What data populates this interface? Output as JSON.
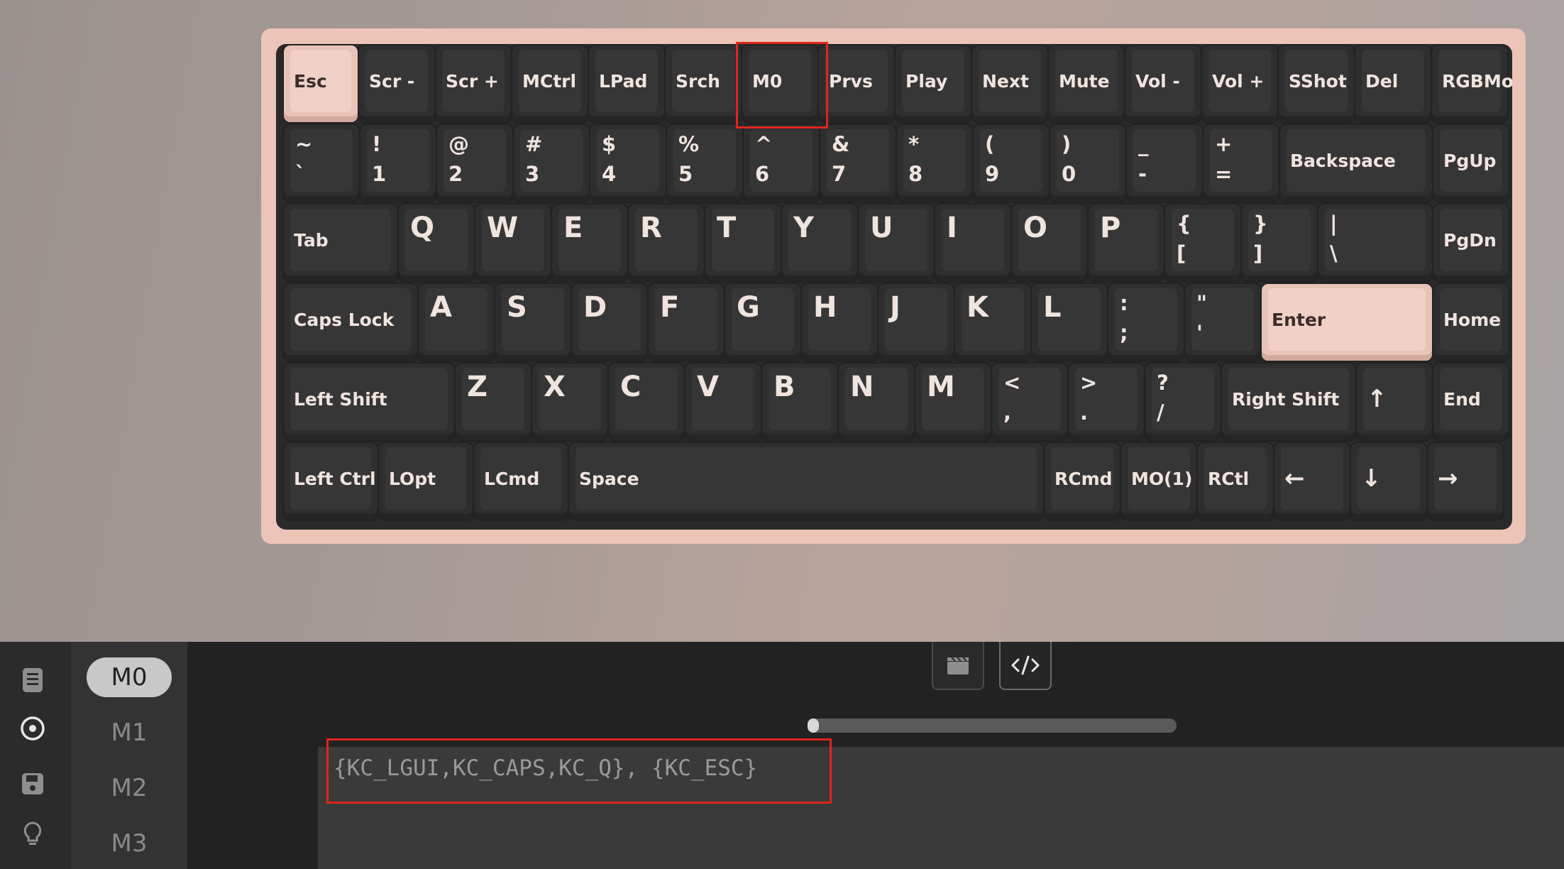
{
  "colors": {
    "accent_highlight": "#e0261c",
    "frame": "#ecc4b8",
    "key_dark": "#363636",
    "key_light": "#f1d1c6"
  },
  "keyboard": {
    "rows": [
      [
        {
          "l": "Esc",
          "light": true
        },
        {
          "l": "Scr -"
        },
        {
          "l": "Scr +"
        },
        {
          "l": "MCtrl"
        },
        {
          "l": "LPad"
        },
        {
          "l": "Srch"
        },
        {
          "l": "M0"
        },
        {
          "l": "Prvs"
        },
        {
          "l": "Play"
        },
        {
          "l": "Next"
        },
        {
          "l": "Mute"
        },
        {
          "l": "Vol -"
        },
        {
          "l": "Vol +"
        },
        {
          "l": "SShot"
        },
        {
          "l": "Del"
        },
        {
          "l": "RGBMod"
        }
      ],
      [
        {
          "l": "~\n`"
        },
        {
          "l": "!\n1"
        },
        {
          "l": "@\n2"
        },
        {
          "l": "#\n3"
        },
        {
          "l": "$\n4"
        },
        {
          "l": "%\n5"
        },
        {
          "l": "^\n6"
        },
        {
          "l": "&\n7"
        },
        {
          "l": "*\n8"
        },
        {
          "l": "(\n9"
        },
        {
          "l": ")\n0"
        },
        {
          "l": "_\n-"
        },
        {
          "l": "+\n="
        },
        {
          "l": "Backspace"
        },
        {
          "l": "PgUp"
        }
      ],
      [
        {
          "l": "Tab"
        },
        {
          "l": "Q"
        },
        {
          "l": "W"
        },
        {
          "l": "E"
        },
        {
          "l": "R"
        },
        {
          "l": "T"
        },
        {
          "l": "Y"
        },
        {
          "l": "U"
        },
        {
          "l": "I"
        },
        {
          "l": "O"
        },
        {
          "l": "P"
        },
        {
          "l": "{\n["
        },
        {
          "l": "}\n]"
        },
        {
          "l": "|\n\\"
        },
        {
          "l": "PgDn"
        }
      ],
      [
        {
          "l": "Caps Lock"
        },
        {
          "l": "A"
        },
        {
          "l": "S"
        },
        {
          "l": "D"
        },
        {
          "l": "F"
        },
        {
          "l": "G"
        },
        {
          "l": "H"
        },
        {
          "l": "J"
        },
        {
          "l": "K"
        },
        {
          "l": "L"
        },
        {
          "l": ":\n;"
        },
        {
          "l": "\"\n'"
        },
        {
          "l": "Enter",
          "light": true
        },
        {
          "l": "Home"
        }
      ],
      [
        {
          "l": "Left Shift"
        },
        {
          "l": "Z"
        },
        {
          "l": "X"
        },
        {
          "l": "C"
        },
        {
          "l": "V"
        },
        {
          "l": "B"
        },
        {
          "l": "N"
        },
        {
          "l": "M"
        },
        {
          "l": "<\n,"
        },
        {
          "l": ">\n."
        },
        {
          "l": "?\n/"
        },
        {
          "l": "Right Shift"
        },
        {
          "l": "↑"
        },
        {
          "l": "End"
        }
      ],
      [
        {
          "l": "Left Ctrl"
        },
        {
          "l": "LOpt"
        },
        {
          "l": "LCmd"
        },
        {
          "l": "Space"
        },
        {
          "l": "RCmd"
        },
        {
          "l": "MO(1)"
        },
        {
          "l": "RCtl"
        },
        {
          "l": "←"
        },
        {
          "l": "↓"
        },
        {
          "l": "→"
        }
      ]
    ]
  },
  "layers": {
    "items": [
      "M0",
      "M1",
      "M2",
      "M3"
    ],
    "active": "M0"
  },
  "rail": {
    "icons": [
      "keyboard-list-icon",
      "target-icon",
      "save-icon",
      "lightbulb-icon"
    ]
  },
  "tabs": [
    {
      "icon": "clapperboard-icon",
      "active": false
    },
    {
      "icon": "code-icon",
      "active": true
    }
  ],
  "slider": {
    "value": 0.0
  },
  "macro": {
    "text": "{KC_LGUI,KC_CAPS,KC_Q}, {KC_ESC}"
  }
}
